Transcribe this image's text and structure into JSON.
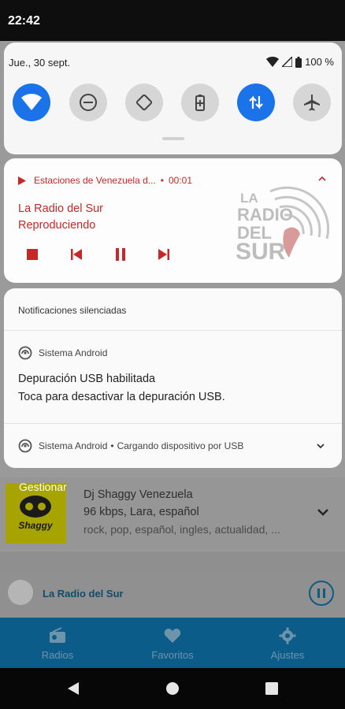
{
  "status_bar": {
    "time": "22:42"
  },
  "quick_settings": {
    "date": "Jue., 30 sept.",
    "battery": "100 %",
    "tiles": [
      {
        "icon": "wifi-icon",
        "state": "on"
      },
      {
        "icon": "do-not-disturb-icon",
        "state": "off"
      },
      {
        "icon": "auto-rotate-icon",
        "state": "off"
      },
      {
        "icon": "battery-saver-icon",
        "state": "off"
      },
      {
        "icon": "mobile-data-icon",
        "state": "on"
      },
      {
        "icon": "airplane-mode-icon",
        "state": "off"
      }
    ]
  },
  "media": {
    "app_line": "Estaciones de Venezuela d...",
    "dot": "•",
    "elapsed": "00:01",
    "title": "La Radio del Sur",
    "status": "Reproduciendo",
    "logo_lines": [
      "LA",
      "RADIO",
      "DEL",
      "SUR"
    ],
    "accent": "#c62828"
  },
  "silent": {
    "header": "Notificaciones silenciadas",
    "notif1": {
      "app": "Sistema Android",
      "title": "Depuración USB habilitada",
      "text": "Toca para desactivar la depuración USB."
    },
    "notif2": {
      "app": "Sistema Android",
      "dot": "•",
      "text": "Cargando dispositivo por USB"
    }
  },
  "background": {
    "manage_label": "Gestionar",
    "station": {
      "name": "Dj Shaggy Venezuela",
      "info": "96 kbps, Lara, español",
      "tags": "rock, pop, español, ingles, actualidad, ..."
    },
    "player": {
      "name": "La Radio del Sur"
    },
    "nav": [
      {
        "label": "Radios",
        "icon": "radio-icon"
      },
      {
        "label": "Favoritos",
        "icon": "heart-icon"
      },
      {
        "label": "Ajustes",
        "icon": "gear-icon"
      }
    ]
  },
  "system_nav": [
    "back-icon",
    "home-icon",
    "recents-icon"
  ]
}
